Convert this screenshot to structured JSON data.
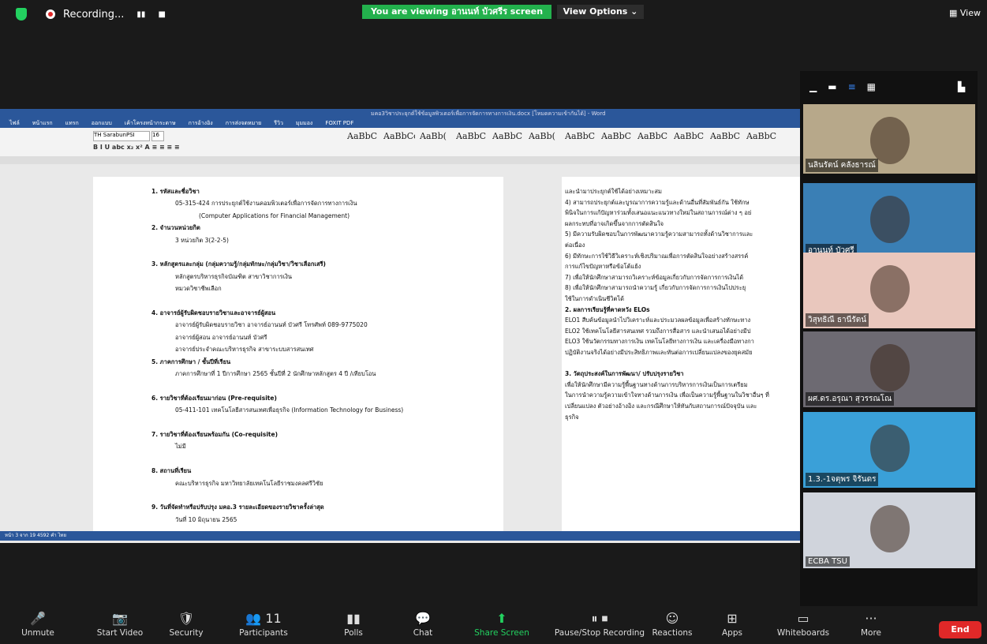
{
  "top": {
    "recording": "Recording...",
    "viewing": "You are viewing อานนท์ บัวศรีร screen",
    "view_options": "View Options ⌄",
    "view": "View"
  },
  "word": {
    "title": "มคอ3วิชาประยุกต์ใช้ข้อมูลพิวเตอร์เพื่อการจัดการทางการเงิน.docx [โหมดความเข้ากันได้] - Word",
    "tabs": [
      "ไฟล์",
      "หน้าแรก",
      "แทรก",
      "ออกแบบ",
      "เค้าโครงหน้ากระดาษ",
      "การอ้างอิง",
      "การส่งจดหมาย",
      "รีวิว",
      "มุมมอง",
      "FOXIT PDF"
    ],
    "font": "TH SarabunPSI",
    "size": "16",
    "styles": [
      "AaBbC",
      "AaBbCcD",
      "AaBb(",
      "AaBbC",
      "AaBbC",
      "AaBb(",
      "AaBbC",
      "AaBbC",
      "AaBbC",
      "AaBbC",
      "AaBbC",
      "AaBbC"
    ],
    "status": "หน้า 3 จาก 19    4592 คำ    ไทย",
    "left_lines": [
      {
        "t": "1. รหัสและชื่อวิชา",
        "b": true
      },
      {
        "t": "05-315-424    การประยุกต์ใช้งานคอมพิวเตอร์เพื่อการจัดการทางการเงิน",
        "i": 1
      },
      {
        "t": "(Computer Applications for Financial Management)",
        "i": 2
      },
      {
        "t": "2. จำนวนหน่วยกิต",
        "b": true
      },
      {
        "t": "3 หน่วยกิต  3(2-2-5)",
        "i": 1
      },
      {
        "t": ""
      },
      {
        "t": "3. หลักสูตรและกลุ่ม (กลุ่มความรู้/กลุ่มทักษะ/กลุ่มวิชา/วิชาเลือกเสรี)",
        "b": true
      },
      {
        "t": "หลักสูตรบริหารธุรกิจบัณฑิต  สาขาวิชาการเงิน",
        "i": 1
      },
      {
        "t": "หมวดวิชาชีพเลือก",
        "i": 1
      },
      {
        "t": ""
      },
      {
        "t": "4. อาจารย์ผู้รับผิดชอบรายวิชาและอาจารย์ผู้สอน",
        "b": true
      },
      {
        "t": "อาจารย์ผู้รับผิดชอบรายวิชา        อาจารย์อานนท์ บัวศรี    โทรศัพท์ 089-9775020",
        "i": 1
      },
      {
        "t": "อาจารย์ผู้สอน                      อาจารย์อานนท์ บัวศรี",
        "i": 1
      },
      {
        "t": "                                    อาจารย์ประจำคณะบริหารธุรกิจ     สาขาระบบสารสนเทศ",
        "i": 1
      },
      {
        "t": "5. ภาคการศึกษา / ชั้นปีที่เรียน",
        "b": true
      },
      {
        "t": "ภาคการศึกษาที่ 1 ปีการศึกษา 2565 ชั้นปีที่ 2   นักศึกษาหลักสูตร 4 ปี  /เทียบโอน",
        "i": 1
      },
      {
        "t": ""
      },
      {
        "t": "6. รายวิชาที่ต้องเรียนมาก่อน  (Pre-requisite)",
        "b": true
      },
      {
        "t": "05-411-101  เทคโนโลยีสารสนเทศเพื่อธุรกิจ (Information Technology for Business)",
        "i": 1
      },
      {
        "t": ""
      },
      {
        "t": "7. รายวิชาที่ต้องเรียนพร้อมกัน  (Co-requisite)",
        "b": true
      },
      {
        "t": "ไม่มี",
        "i": 1
      },
      {
        "t": ""
      },
      {
        "t": "8. สถานที่เรียน",
        "b": true
      },
      {
        "t": "คณะบริหารธุรกิจ  มหาวิทยาลัยเทคโนโลยีราชมงคลศรีวิชัย",
        "i": 1
      },
      {
        "t": ""
      },
      {
        "t": "9. วันที่จัดทำหรือปรับปรุง มคอ.3 รายละเอียดของรายวิชาครั้งล่าสุด",
        "b": true
      },
      {
        "t": "วันที่ 10 มิถุนายน 2565",
        "i": 1
      }
    ],
    "right_lines": [
      {
        "t": "และนำมาประยุกต์ใช้ได้อย่างเหมาะสม"
      },
      {
        "t": "      4) สามารถประยุกต์และบูรณาการความรู้และด้านอื่นที่สัมพันธ์กัน ใช้ทักษ"
      },
      {
        "t": "พินิจในการแก้ปัญหาร่วมทั้งเสนอแนะแนวทางใหม่ในสถานการณ์ต่าง ๆ อย่"
      },
      {
        "t": "ผลกระทบที่อาจเกิดขึ้นจากการตัดสินใจ"
      },
      {
        "t": "      5) มีความรับผิดชอบในการพัฒนาความรู้ความสามารถทั้งด้านวิชาการและ"
      },
      {
        "t": "ต่อเนื่อง"
      },
      {
        "t": "      6) มีทักษะการใช้วิธีวิเคราะห์เชิงปริมาณเพื่อการตัดสินใจอย่างสร้างสรรค์"
      },
      {
        "t": "การแก้ไขปัญหาหรือข้อโต้แย้ง"
      },
      {
        "t": "      7) เพื่อให้นักศึกษาสามารถวิเคราะห์ข้อมูลเกี่ยวกับการจัดการการเงินได้"
      },
      {
        "t": "      8) เพื่อให้นักศึกษาสามารถนำความรู้ เกี่ยวกับการจัดการการเงินไปประยุ"
      },
      {
        "t": "ใช้ในการดำเนินชีวิตได้"
      },
      {
        "t": "2. ผลการเรียนรู้ที่คาดหวัง ELOs",
        "b": true
      },
      {
        "t": "      ELO1 สืบค้นข้อมูลนำไปวิเคราะห์และประมวลผลข้อมูลเพื่อสร้างทักษะทาง"
      },
      {
        "t": "      ELO2 ใช้เทคโนโลยีสารสนเทศ รวมถึงการสื่อสาร และนำเสนอได้อย่างมีป"
      },
      {
        "t": "      ELO3 ใช้นวัตกรรมทางการเงิน เทคโนโลยีทางการเงิน และเครื่องมือทางกา"
      },
      {
        "t": "ปฏิบัติงานจริงได้อย่างมีประสิทธิภาพและทันต่อการเปลี่ยนแปลงของยุคสมัย"
      },
      {
        "t": ""
      },
      {
        "t": "3. วัตถุประสงค์ในการพัฒนา/ ปรับปรุงรายวิชา",
        "b": true
      },
      {
        "t": "      เพื่อให้นักศึกษามีความรู้พื้นฐานทางด้านการบริหารการเงินเป็นการเตรียม"
      },
      {
        "t": "ในการนำความรู้ความเข้าใจทางด้านการเงิน เพื่อเป็นความรู้พื้นฐานในวิชาอื่นๆ ที่"
      },
      {
        "t": "เปลี่ยนแปลง ตัวอย่างอ้างอิง และกรณีศึกษาให้ทันกับสถานการณ์ปัจจุบัน และ"
      },
      {
        "t": "ธุรกิจ"
      }
    ]
  },
  "gallery": {
    "participants": [
      {
        "name": "นลินรัตน์ คลังธารณ์",
        "bg": "#b7a88a"
      },
      {
        "name": "อานนท์ บัวศรี",
        "bg": "#3a7fb5"
      },
      {
        "name": "วิสุทธิณี ธานีรัตน์",
        "bg": "#e9c7bd"
      },
      {
        "name": "ผศ.ดร.อรุณา สุวรรณโณ",
        "bg": "#6d6a72"
      },
      {
        "name": "1.3.-1จตุพร จิรันดร",
        "bg": "#3aa0d8"
      },
      {
        "name": "ECBA TSU",
        "bg": "#d0d4dc"
      }
    ]
  },
  "toolbar": {
    "items": [
      {
        "label": "Unmute",
        "icon": "🎤"
      },
      {
        "label": "Start Video",
        "icon": "📷"
      },
      {
        "label": "Security",
        "icon": "🛡"
      },
      {
        "label": "Participants",
        "icon": "👥 11"
      },
      {
        "label": "Polls",
        "icon": "▮▮"
      },
      {
        "label": "Chat",
        "icon": "💬"
      },
      {
        "label": "Share Screen",
        "icon": "⬆"
      },
      {
        "label": "Pause/Stop Recording",
        "icon": "⏸ ⏹"
      },
      {
        "label": "Reactions",
        "icon": "☺"
      },
      {
        "label": "Apps",
        "icon": "⊞"
      },
      {
        "label": "Whiteboards",
        "icon": "▭"
      },
      {
        "label": "More",
        "icon": "···"
      }
    ],
    "end": "End"
  },
  "colors": {
    "accent": "#23b14d",
    "word_blue": "#2b579a",
    "end_red": "#e02828"
  }
}
